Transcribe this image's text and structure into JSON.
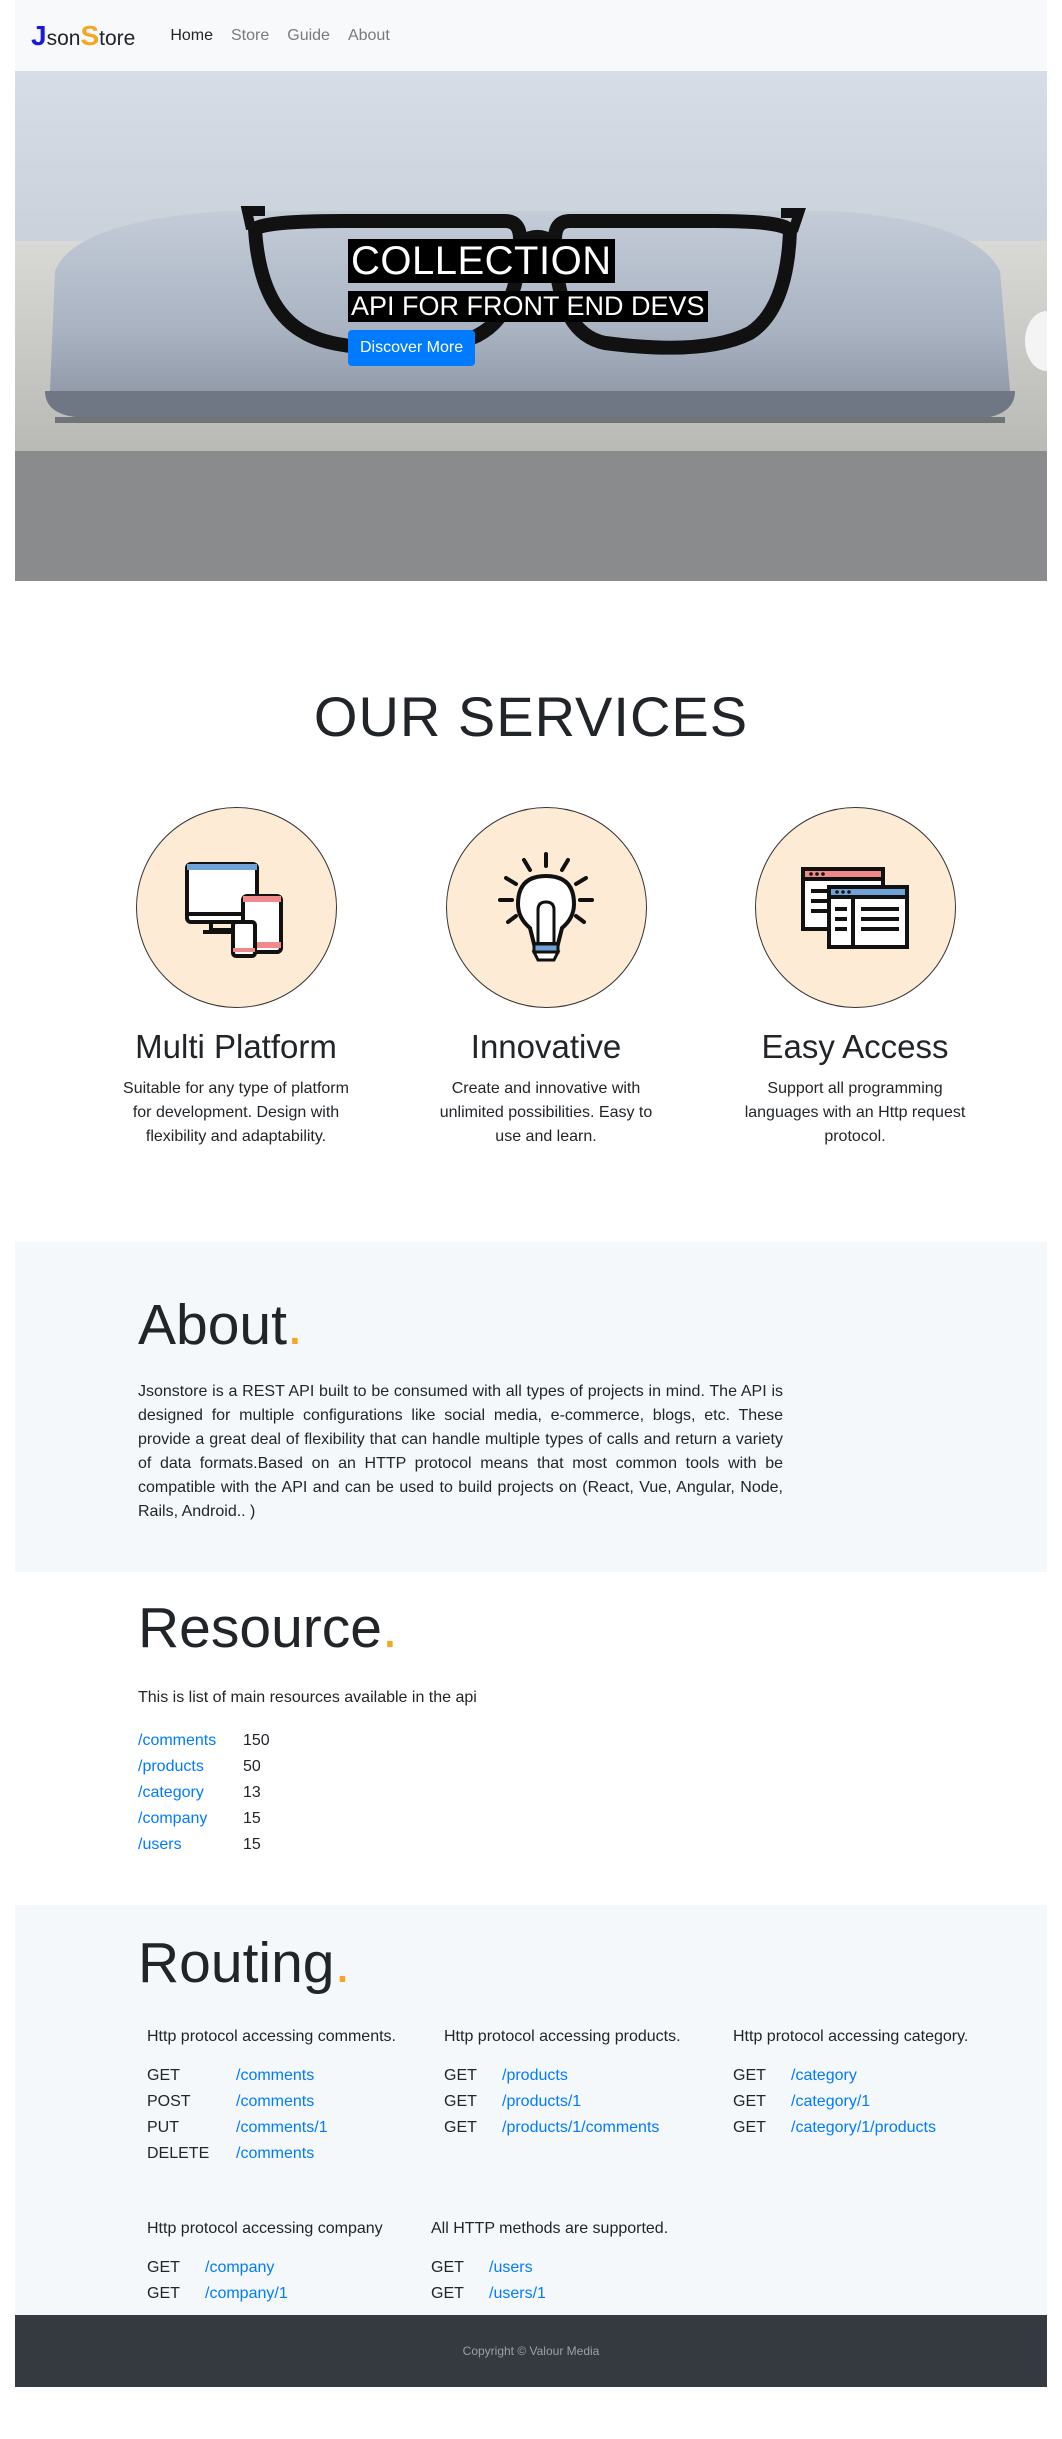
{
  "navbar": {
    "brand_j": "J",
    "brand_son": "son",
    "brand_s": "S",
    "brand_tore": "tore",
    "links": [
      "Home",
      "Store",
      "Guide",
      "About"
    ]
  },
  "hero": {
    "title": "COLLECTION",
    "subtitle": "API FOR FRONT END DEVS",
    "button": "Discover More"
  },
  "services": {
    "title": "OUR SERVICES",
    "items": [
      {
        "title": "Multi Platform",
        "text": "Suitable for any type of platform for development. Design with flexibility and adaptability.",
        "icon": "devices-icon"
      },
      {
        "title": "Innovative",
        "text": "Create and innovative with unlimited possibilities. Easy to use and learn.",
        "icon": "lightbulb-icon"
      },
      {
        "title": "Easy Access",
        "text": "Support all programming languages with an Http request protocol.",
        "icon": "browser-windows-icon"
      }
    ]
  },
  "about": {
    "title": "About",
    "dot": ".",
    "text": "Jsonstore is a REST API built to be consumed with all types of projects in mind. The API is designed for multiple configurations like social media, e-commerce, blogs, etc. These provide a great deal of flexibility that can handle multiple types of calls and return a variety of data formats.Based on an HTTP protocol means that most common tools with be compatible with the API and can be used to build projects on (React, Vue, Angular, Node, Rails, Android.. )"
  },
  "resource": {
    "title": "Resource",
    "dot": ".",
    "intro": "This is list of main resources available in the api",
    "items": [
      {
        "path": "/comments",
        "count": "150"
      },
      {
        "path": "/products",
        "count": "50"
      },
      {
        "path": "/category",
        "count": "13"
      },
      {
        "path": "/company",
        "count": "15"
      },
      {
        "path": "/users",
        "count": "15"
      }
    ]
  },
  "routing": {
    "title": "Routing",
    "dot": ".",
    "groups": [
      {
        "head": "Http protocol accessing comments.",
        "routes": [
          {
            "method": "GET",
            "path": "/comments"
          },
          {
            "method": "POST",
            "path": "/comments"
          },
          {
            "method": "PUT",
            "path": "/comments/1"
          },
          {
            "method": "DELETE",
            "path": "/comments"
          }
        ]
      },
      {
        "head": "Http protocol accessing products.",
        "routes": [
          {
            "method": "GET",
            "path": "/products"
          },
          {
            "method": "GET",
            "path": "/products/1"
          },
          {
            "method": "GET",
            "path": "/products/1/comments"
          }
        ]
      },
      {
        "head": "Http protocol accessing category.",
        "routes": [
          {
            "method": "GET",
            "path": "/category"
          },
          {
            "method": "GET",
            "path": "/category/1"
          },
          {
            "method": "GET",
            "path": "/category/1/products"
          }
        ]
      },
      {
        "head": "Http protocol accessing company",
        "routes": [
          {
            "method": "GET",
            "path": "/company"
          },
          {
            "method": "GET",
            "path": "/company/1"
          }
        ]
      },
      {
        "head": "All HTTP methods are supported.",
        "routes": [
          {
            "method": "GET",
            "path": "/users"
          },
          {
            "method": "GET",
            "path": "/users/1"
          }
        ]
      }
    ]
  },
  "footer": {
    "text": "Copyright © Valour Media"
  }
}
